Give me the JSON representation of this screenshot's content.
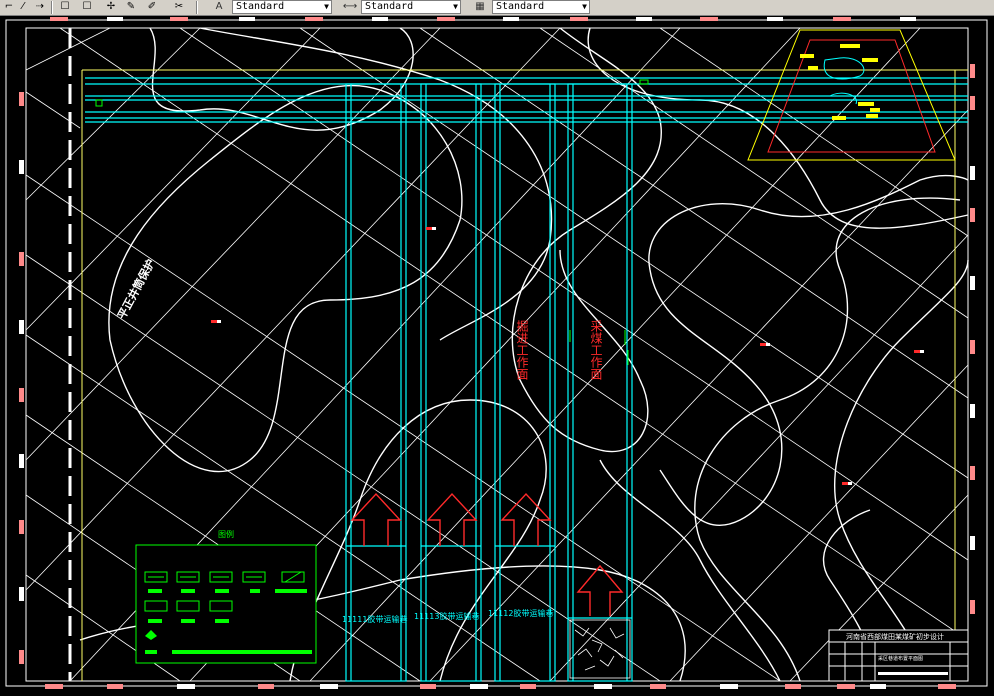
{
  "toolbar": {
    "text_style": "Standard",
    "dim_style": "Standard",
    "table_style": "Standard",
    "icons": [
      "polyline-icon",
      "arc-icon",
      "rectangle-icon",
      "square-icon",
      "move-icon",
      "pencil-icon",
      "marker-icon",
      "tools-icon"
    ]
  },
  "drawing": {
    "colors": {
      "background": "#000000",
      "contour": "#ffffff",
      "roadway": "#00ffff",
      "frame": "#ffff66",
      "label_red": "#ff2a2a",
      "legend_green": "#00ff00",
      "yellow_block": "#ffff00",
      "border_tick": "#ff8a8a"
    },
    "left_label": "平正井筒保护",
    "face_labels": [
      "掘进工作面",
      "采煤工作面"
    ],
    "roadway_labels": [
      "11111胶带运输巷",
      "11113胶带运输巷",
      "11112胶带运输巷"
    ],
    "legend_title": "图例",
    "title_block": {
      "title": "河南省西部煤田某煤矿初步设计",
      "subtitle": "采区巷道布置平面图"
    }
  }
}
